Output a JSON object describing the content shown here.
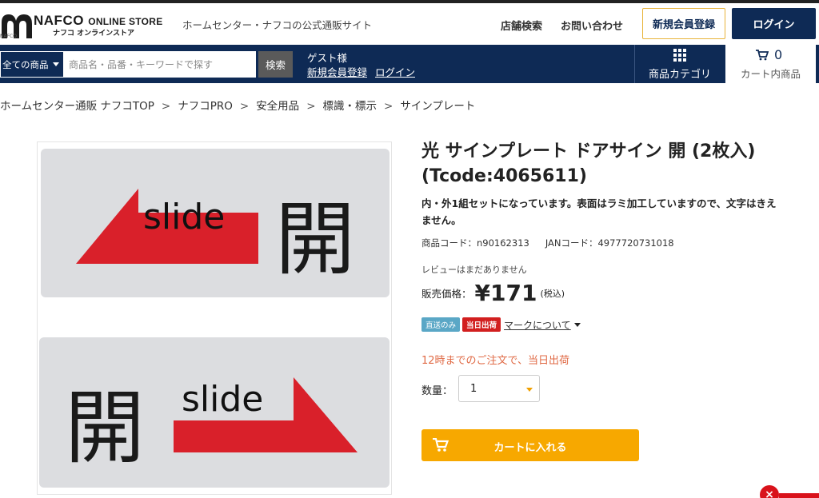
{
  "header": {
    "logo_main": "NAFCO",
    "logo_main_suffix": "ONLINE STORE",
    "logo_sub": "ナフコ オンラインストア",
    "logo_tiny": "NAFCO",
    "tagline": "ホームセンター・ナフコの公式通販サイト",
    "store_search": "店舗検索",
    "contact": "お問い合わせ",
    "register": "新規会員登録",
    "login": "ログイン"
  },
  "nav": {
    "category_select": "全ての商品",
    "search_placeholder": "商品名・品番・キーワードで探す",
    "search_button": "検索",
    "guest": "ゲスト様",
    "guest_register": "新規会員登録",
    "guest_login": "ログイン",
    "category_menu": "商品カテゴリ",
    "cart_count": "0",
    "cart_label": "カート内商品"
  },
  "breadcrumb": {
    "separator": ">",
    "items": [
      "ホームセンター通販 ナフコTOP",
      "ナフコPRO",
      "安全用品",
      "標識・標示",
      "サインプレート"
    ]
  },
  "product_image": {
    "plate_text_word": "slide",
    "plate_text_kanji": "開",
    "arrow_color": "#d9202a",
    "plate_color": "#dcdde0"
  },
  "product": {
    "title": "光 サインプレート ドアサイン 開 (2枚入)(Tcode:4065611)",
    "description": "内・外1組セットになっています。表面はラミ加工していますので、文字はきえません。",
    "product_code": "商品コード：n90162313",
    "jan_code": "JANコード：4977720731018",
    "review": "レビューはまだありません",
    "price_label": "販売価格：",
    "price": "¥171",
    "tax": "(税込)",
    "badge_direct": "直送のみ",
    "badge_sameday": "当日出荷",
    "mark_link": "マークについて",
    "notice": "12時までのご注文で、当日出荷",
    "qty_label": "数量：",
    "qty_value": "1",
    "add_to_cart": "カートに入れる"
  },
  "colors": {
    "navy": "#0e2a55",
    "accent_orange": "#f7a800",
    "notice_text": "#e06a45",
    "sameday_red": "#d21f1f"
  },
  "floating": {
    "close_glyph": "×"
  }
}
